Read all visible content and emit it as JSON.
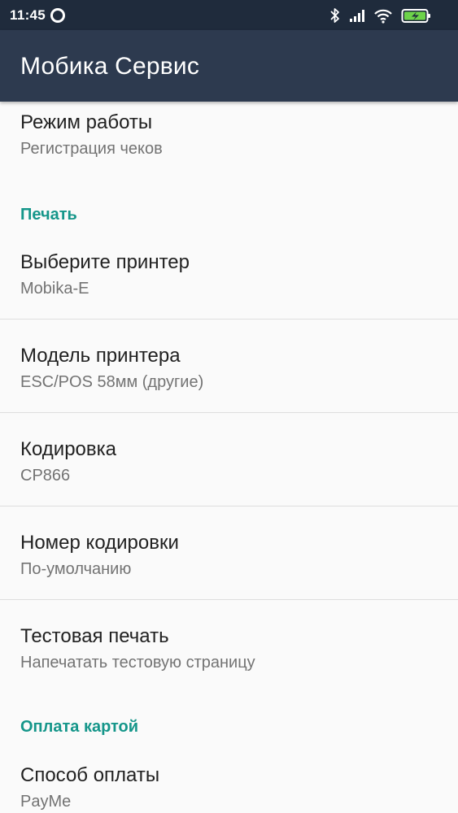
{
  "status_bar": {
    "time": "11:45",
    "icons": [
      "notification-circle-icon",
      "bluetooth-icon",
      "signal-icon",
      "wifi-icon",
      "battery-charging-icon"
    ]
  },
  "app_bar": {
    "title": "Мобика Сервис"
  },
  "items": [
    {
      "title": "Режим работы",
      "summary": "Регистрация чеков"
    },
    {
      "title": "Выберите принтер",
      "summary": "Mobika-E"
    },
    {
      "title": "Модель принтера",
      "summary": "ESC/POS 58мм (другие)"
    },
    {
      "title": "Кодировка",
      "summary": "CP866"
    },
    {
      "title": "Номер кодировки",
      "summary": "По-умолчанию"
    },
    {
      "title": "Тестовая печать",
      "summary": "Напечатать тестовую страницу"
    },
    {
      "title": "Способ оплаты",
      "summary": "PayMe"
    }
  ],
  "categories": {
    "print": "Печать",
    "card_payment": "Оплата картой"
  },
  "colors": {
    "status_bar": "#1f2b3c",
    "app_bar": "#2d3a4f",
    "accent": "#15968a",
    "battery": "#6dd34a"
  }
}
